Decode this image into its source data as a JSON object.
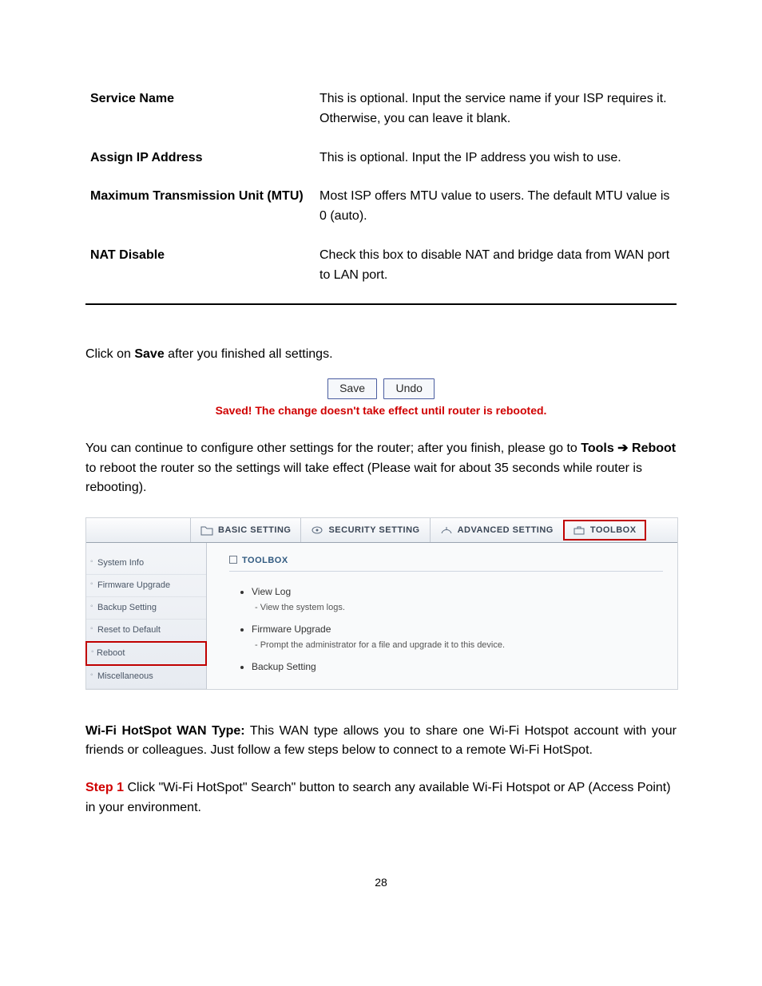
{
  "defs": [
    {
      "label": "Service Name",
      "text": "This is optional. Input the service name if your ISP requires it. Otherwise, you can leave it blank."
    },
    {
      "label": "Assign IP Address",
      "text": "This is optional. Input the IP address you wish to use."
    },
    {
      "label": "Maximum Transmission Unit (MTU)",
      "text": "Most ISP offers MTU value to users. The default MTU value is 0 (auto)."
    },
    {
      "label": "NAT Disable",
      "text": "Check this box to disable NAT and bridge data from WAN port to LAN port."
    }
  ],
  "p_click_save_pre": "Click on ",
  "p_click_save_bold": "Save",
  "p_click_save_post": " after you finished all settings.",
  "btn_save": "Save",
  "btn_undo": "Undo",
  "saved_msg": "Saved! The change doesn't take effect until router is rebooted.",
  "p_continue_pre": "You can continue to configure other settings for the router; after you finish, please go to ",
  "p_continue_bold": "Tools ➔ Reboot",
  "p_continue_post": " to reboot the router so the settings will take effect (Please wait for about 35 seconds while router is rebooting).",
  "tabs": {
    "basic": "BASIC SETTING",
    "security": "SECURITY SETTING",
    "advanced": "ADVANCED SETTING",
    "toolbox": "TOOLBOX"
  },
  "side": {
    "system_info": "System Info",
    "firmware_upgrade": "Firmware Upgrade",
    "backup_setting": "Backup Setting",
    "reset_default": "Reset to Default",
    "reboot": "Reboot",
    "misc": "Miscellaneous"
  },
  "panel_title": "TOOLBOX",
  "features": [
    {
      "title": "View Log",
      "desc": "- View the system logs."
    },
    {
      "title": "Firmware Upgrade",
      "desc": "- Prompt the administrator for a file and upgrade it to this device."
    },
    {
      "title": "Backup Setting",
      "desc": ""
    }
  ],
  "wifi_bold": "Wi-Fi HotSpot WAN Type:",
  "wifi_text": " This WAN type allows you to share one Wi-Fi Hotspot account with your friends or colleagues. Just follow a few steps below to connect to a remote Wi-Fi HotSpot.",
  "step1_label": "Step 1",
  "step1_text": " Click \"Wi-Fi HotSpot\" Search\" button to search any available Wi-Fi Hotspot or AP (Access Point) in your environment.",
  "page_num": "28"
}
